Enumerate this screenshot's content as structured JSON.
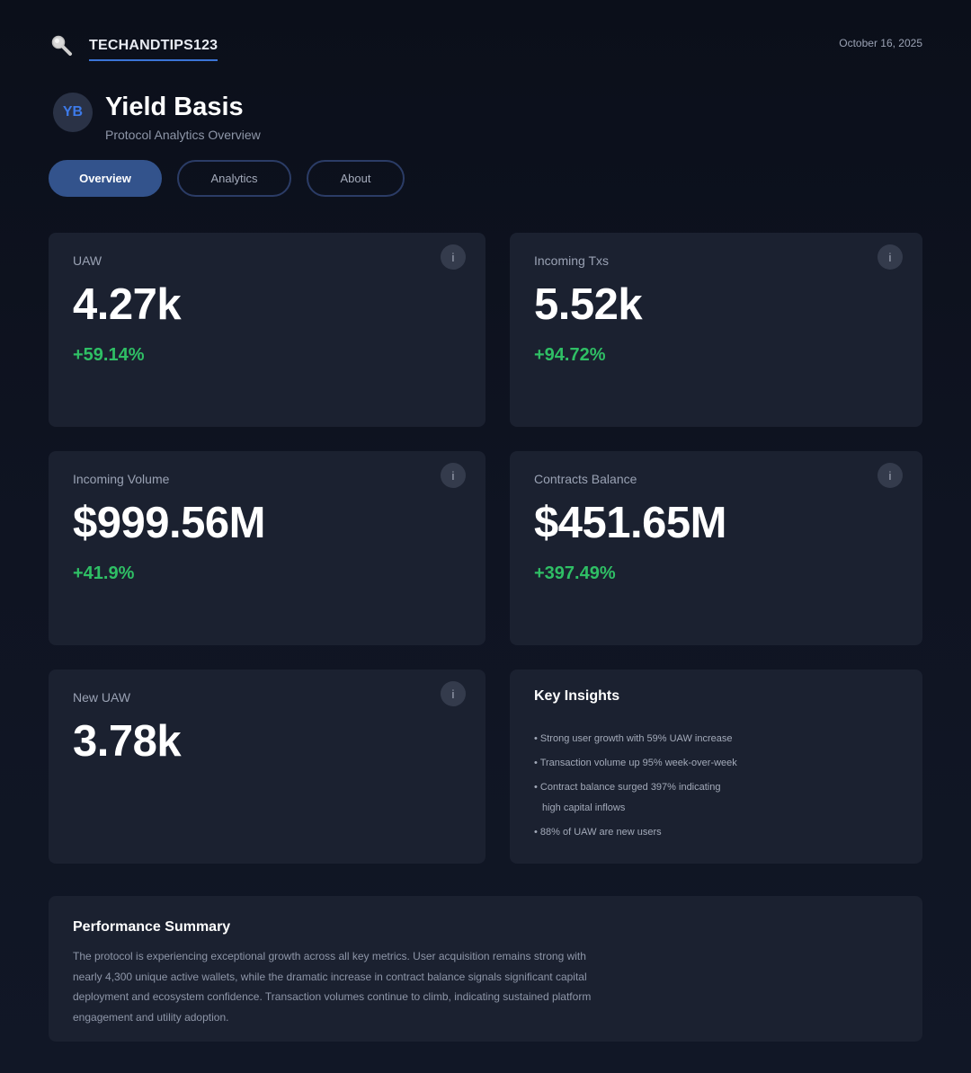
{
  "brand": {
    "name": "TECHANDTIPS123",
    "logo_icon": "magnifier-icon"
  },
  "date": "October 16, 2025",
  "header": {
    "avatar_initials": "YB",
    "title": "Yield Basis",
    "subtitle": "Protocol Analytics Overview"
  },
  "tabs": [
    {
      "label": "Overview",
      "active": true
    },
    {
      "label": "Analytics",
      "active": false
    },
    {
      "label": "About",
      "active": false
    }
  ],
  "metrics": [
    {
      "label": "UAW",
      "value": "4.27k",
      "change": "+59.14%"
    },
    {
      "label": "Incoming Txs",
      "value": "5.52k",
      "change": "+94.72%"
    },
    {
      "label": "Incoming Volume",
      "value": "$999.56M",
      "change": "+41.9%"
    },
    {
      "label": "Contracts Balance",
      "value": "$451.65M",
      "change": "+397.49%"
    },
    {
      "label": "New UAW",
      "value": "3.78k"
    }
  ],
  "info_glyph": "i",
  "insights": {
    "title": "Key Insights",
    "items": [
      "• Strong user growth with 59% UAW increase",
      "• Transaction volume up 95% week-over-week",
      "• Contract balance surged 397% indicating",
      "high capital inflows",
      "• 88% of UAW are new users"
    ]
  },
  "summary": {
    "title": "Performance Summary",
    "text": "The protocol is experiencing exceptional growth across all key metrics. User acquisition remains strong with nearly 4,300 unique active wallets, while the dramatic increase in contract balance signals significant capital deployment and ecosystem confidence. Transaction volumes continue to climb, indicating sustained platform engagement and utility adoption."
  },
  "colors": {
    "accent": "#3b74d6",
    "positive": "#2fbf65",
    "card": "#1b2130",
    "tab_active": "#33538c"
  }
}
